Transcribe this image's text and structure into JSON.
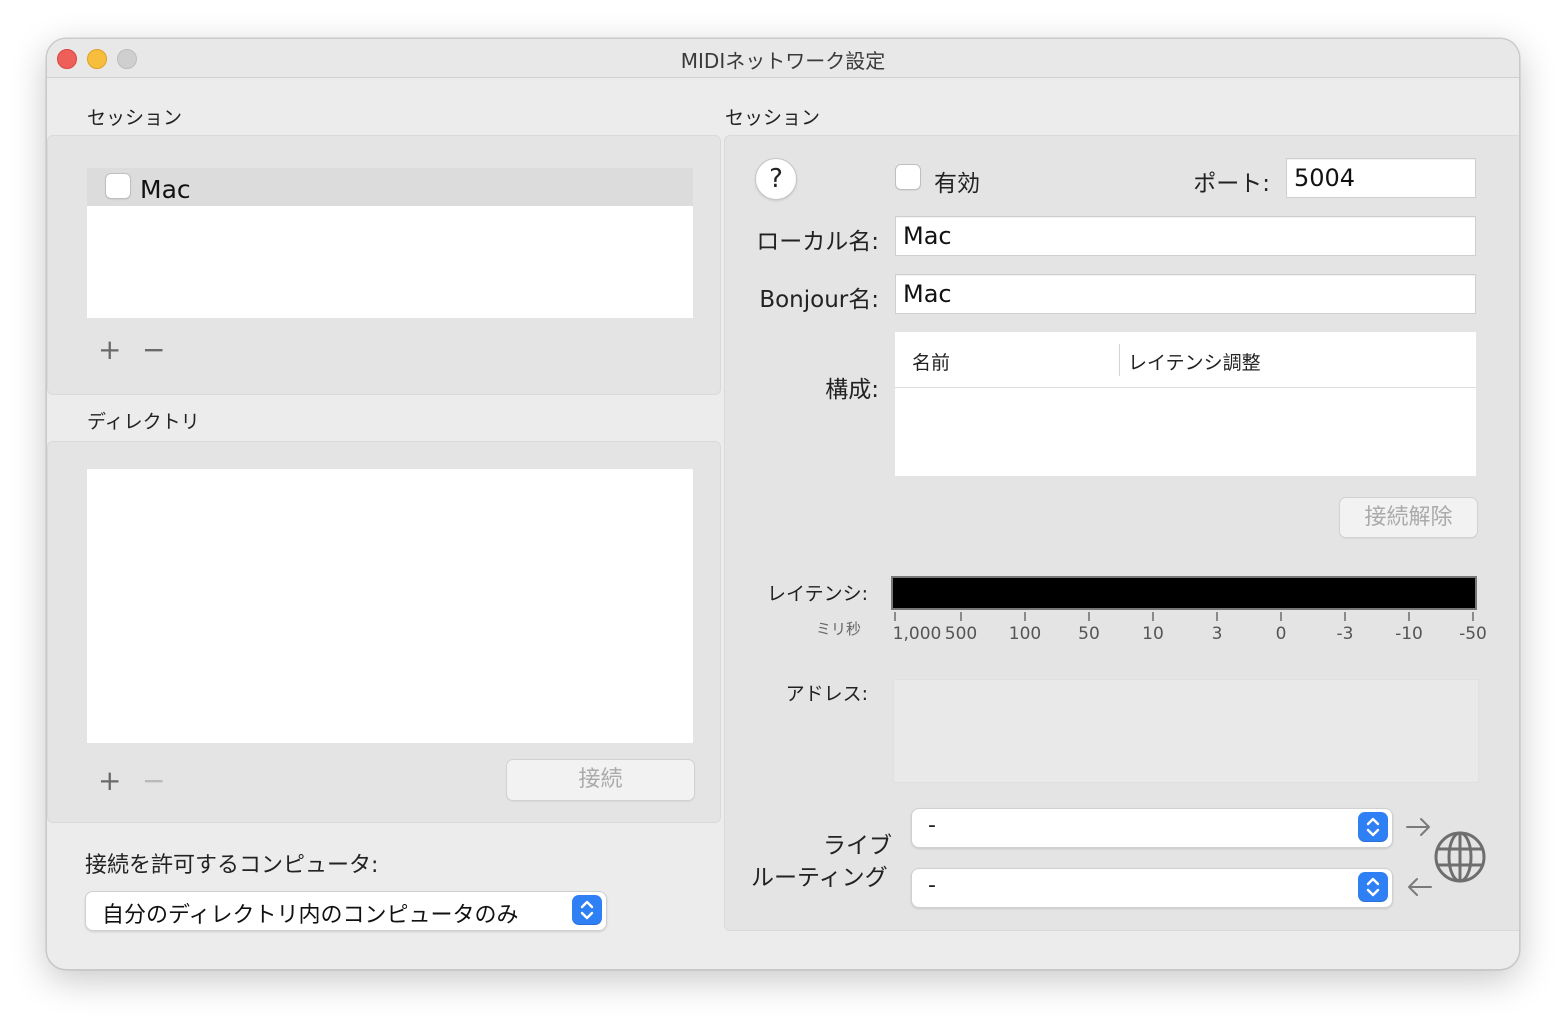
{
  "window": {
    "title": "MIDIネットワーク設定"
  },
  "left": {
    "session_label": "セッション",
    "sessions": [
      {
        "name": "Mac",
        "checked": false
      }
    ],
    "add_symbol": "+",
    "remove_symbol": "−",
    "directory_label": "ディレクトリ",
    "connect_button": "接続",
    "allow_label": "接続を許可するコンピュータ:",
    "allow_value": "自分のディレクトリ内のコンピュータのみ"
  },
  "right": {
    "session_label": "セッション",
    "help_symbol": "?",
    "enabled_label": "有効",
    "port_label": "ポート:",
    "port_value": "5004",
    "local_name_label": "ローカル名:",
    "local_name_value": "Mac",
    "bonjour_label": "Bonjour名:",
    "bonjour_value": "Mac",
    "config_label": "構成:",
    "columns": [
      "名前",
      "レイテンシ調整"
    ],
    "disconnect_button": "接続解除",
    "latency_label": "レイテンシ:",
    "ms_label": "ミリ秒",
    "ticks": [
      "1,000",
      "500",
      "100",
      "50",
      "10",
      "3",
      "0",
      "-3",
      "-10",
      "-50"
    ],
    "address_label": "アドレス:",
    "live_routing_label_1": "ライブ",
    "live_routing_label_2": "ルーティング",
    "routing_in_value": "-",
    "routing_out_value": "-"
  },
  "colors": {
    "accent": "#2f7ff5",
    "close": "#ee5f5a",
    "minimize": "#f6be3c",
    "zoom": "#cfcfcf"
  }
}
